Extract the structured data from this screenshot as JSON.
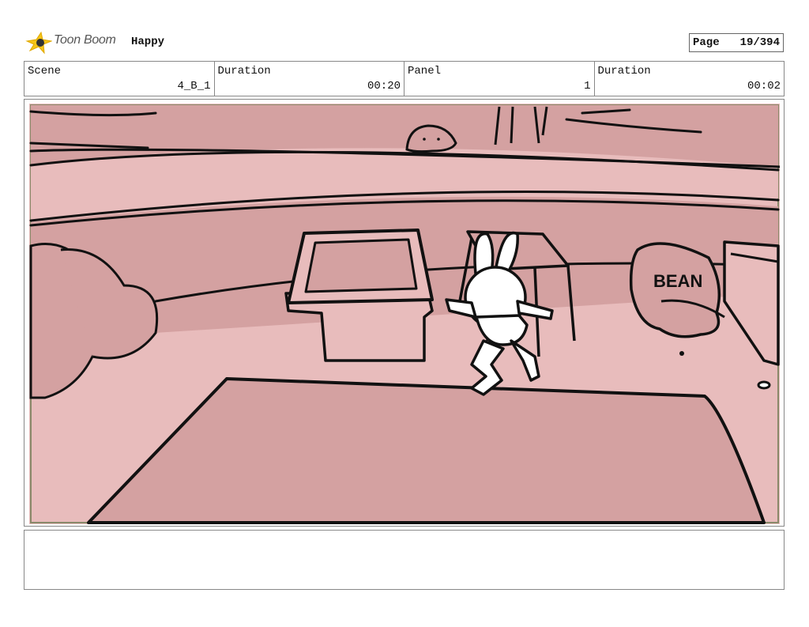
{
  "header": {
    "brand": "Toon Boom",
    "project_title": "Happy",
    "page_label": "Page",
    "page_value": "19/394"
  },
  "info": {
    "scene_label": "Scene",
    "scene_value": "4_B_1",
    "scene_duration_label": "Duration",
    "scene_duration_value": "00:20",
    "panel_label": "Panel",
    "panel_value": "1",
    "panel_duration_label": "Duration",
    "panel_duration_value": "00:02"
  },
  "panel": {
    "bag_text": "BEAN"
  },
  "notes": {
    "text": ""
  }
}
